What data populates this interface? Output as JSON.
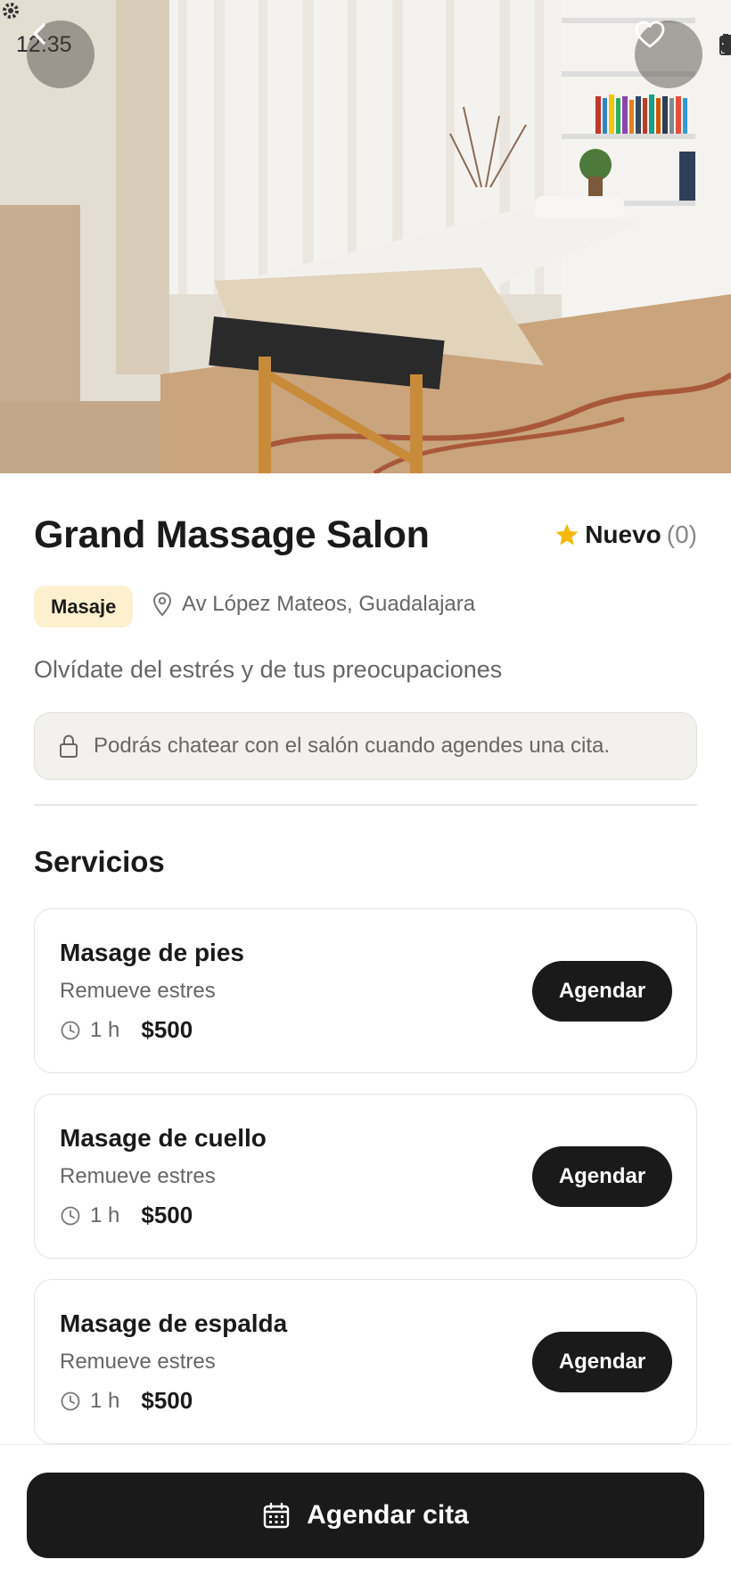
{
  "status_bar": {
    "time": "12:35"
  },
  "hero": {
    "image_description_icon": "massage-room-photo"
  },
  "salon": {
    "name": "Grand Massage Salon",
    "rating_label": "Nuevo",
    "rating_count": "(0)",
    "category": "Masaje",
    "address": "Av López Mateos, Guadalajara",
    "tagline": "Olvídate del estrés y de tus preocupaciones",
    "chat_notice": "Podrás chatear con el salón cuando agendes una cita."
  },
  "services_section": {
    "title": "Servicios",
    "items": [
      {
        "name": "Masage de pies",
        "description": "Remueve estres",
        "duration": "1 h",
        "price": "$500",
        "button": "Agendar"
      },
      {
        "name": "Masage de cuello",
        "description": "Remueve estres",
        "duration": "1 h",
        "price": "$500",
        "button": "Agendar"
      },
      {
        "name": "Masage de espalda",
        "description": "Remueve estres",
        "duration": "1 h",
        "price": "$500",
        "button": "Agendar"
      }
    ]
  },
  "cta": {
    "label": "Agendar cita"
  },
  "colors": {
    "accent_star": "#f5b800",
    "tag_bg": "#fdf0cf",
    "button_bg": "#1a1a1a"
  }
}
